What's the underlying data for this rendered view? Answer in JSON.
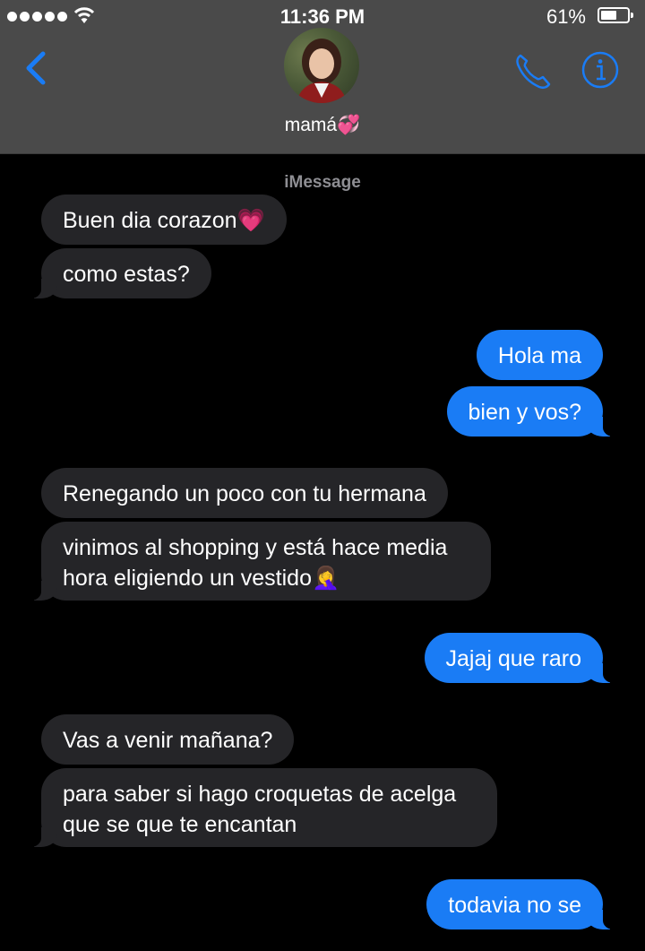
{
  "status_bar": {
    "time": "11:36 PM",
    "battery_percent": "61%",
    "battery_level": 0.61,
    "signal_bars": 5
  },
  "header": {
    "contact_name": "mamá💞",
    "back_icon": "chevron-left-icon",
    "call_icon": "phone-icon",
    "info_icon": "info-icon",
    "accent_color": "#1a7cf5"
  },
  "thread": {
    "service_label": "iMessage",
    "messages": [
      {
        "from": "contact",
        "text": "Buen dia corazon💗"
      },
      {
        "from": "contact",
        "text": "como estas?"
      },
      {
        "from": "me",
        "text": "Hola ma"
      },
      {
        "from": "me",
        "text": "bien y vos?"
      },
      {
        "from": "contact",
        "text": "Renegando un poco con tu hermana"
      },
      {
        "from": "contact",
        "text": "vinimos al shopping y está hace media hora eligiendo un vestido🤦‍♀️"
      },
      {
        "from": "me",
        "text": "Jajaj que raro"
      },
      {
        "from": "contact",
        "text": "Vas a venir mañana?"
      },
      {
        "from": "contact",
        "text": "para saber si hago croquetas de acelga que se que te encantan"
      },
      {
        "from": "me",
        "text": "todavia no se"
      }
    ]
  }
}
